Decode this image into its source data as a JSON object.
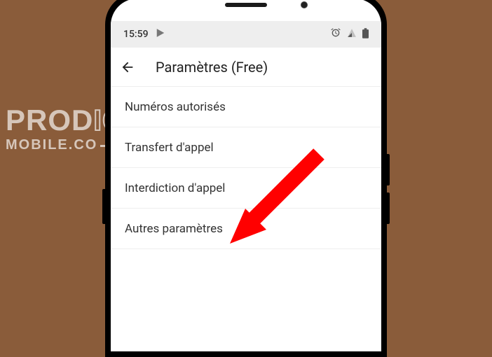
{
  "statusBar": {
    "time": "15:59"
  },
  "header": {
    "title": "Paramètres (Free)"
  },
  "menu": {
    "items": [
      {
        "label": "Numéros autorisés"
      },
      {
        "label": "Transfert d'appel"
      },
      {
        "label": "Interdiction d'appel"
      },
      {
        "label": "Autres paramètres"
      }
    ]
  },
  "watermark": {
    "line1a": "PROD",
    "line1b": "IGE",
    "line2": "MOBILE.CO"
  }
}
